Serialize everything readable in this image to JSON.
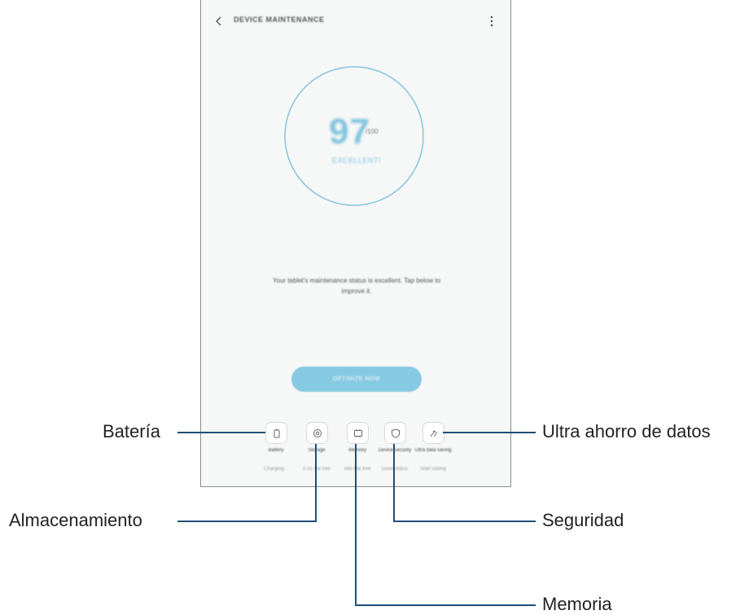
{
  "app": {
    "title": "DEVICE MAINTENANCE",
    "score": "97",
    "score_max": "/100",
    "status": "EXCELLENT!",
    "description": "Your tablet's maintenance status is excellent. Tap below to improve it.",
    "fix_button": "OPTIMIZE NOW"
  },
  "features": [
    {
      "label": "Battery",
      "value": "Charging...",
      "icon": "battery-icon"
    },
    {
      "label": "Storage",
      "value": "0.31 GB free",
      "icon": "storage-icon"
    },
    {
      "label": "Memory",
      "value": "488 MB free",
      "icon": "memory-icon"
    },
    {
      "label": "Device security",
      "value": "Good status",
      "icon": "shield-icon"
    },
    {
      "label": "Ultra data saving",
      "value": "Start saving",
      "icon": "data-saving-icon"
    }
  ],
  "callouts": {
    "battery": "Batería",
    "storage": "Almacenamiento",
    "memory": "Memoria",
    "security": "Seguridad",
    "data_saving": "Ultra ahorro de datos"
  },
  "colors": {
    "accent": "#7ec3de",
    "ring": "#86c6de",
    "leader_line": "#1f4e79"
  }
}
